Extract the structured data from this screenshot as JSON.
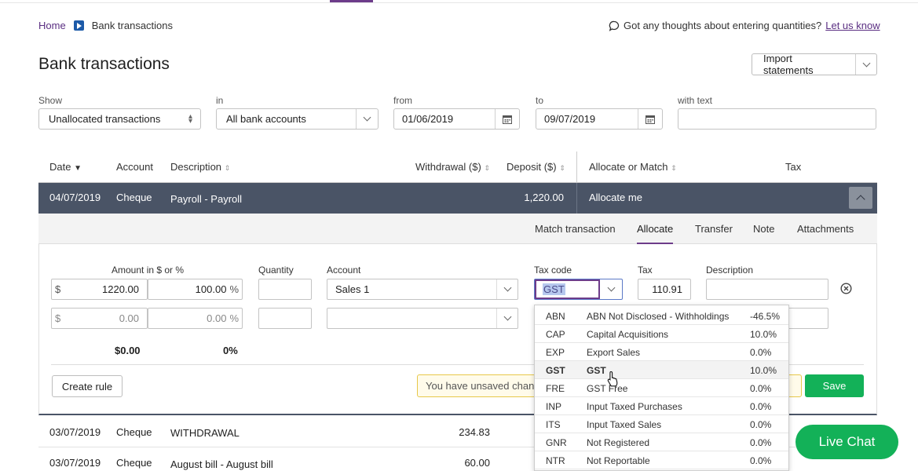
{
  "breadcrumb": {
    "home": "Home",
    "current": "Bank transactions"
  },
  "feedback": {
    "text": "Got any thoughts about entering quantities?",
    "link": "Let us know"
  },
  "page_title": "Bank transactions",
  "import_button": "Import statements",
  "filters": {
    "show_label": "Show",
    "show_value": "Unallocated transactions",
    "in_label": "in",
    "in_value": "All bank accounts",
    "from_label": "from",
    "from_value": "01/06/2019",
    "to_label": "to",
    "to_value": "09/07/2019",
    "text_label": "with text",
    "text_value": ""
  },
  "table": {
    "headers": {
      "date": "Date",
      "account": "Account",
      "description": "Description",
      "withdrawal": "Withdrawal ($)",
      "deposit": "Deposit ($)",
      "allocate": "Allocate or Match",
      "tax": "Tax"
    },
    "selected": {
      "date": "04/07/2019",
      "account": "Cheque",
      "description": "Payroll - Payroll",
      "deposit": "1,220.00",
      "allocate": "Allocate me"
    },
    "rows": [
      {
        "date": "03/07/2019",
        "account": "Cheque",
        "description": "WITHDRAWAL",
        "withdrawal": "234.83"
      },
      {
        "date": "03/07/2019",
        "account": "Cheque",
        "description": "August bill - August bill",
        "withdrawal": "60.00"
      }
    ]
  },
  "subtabs": [
    "Match transaction",
    "Allocate",
    "Transfer",
    "Note",
    "Attachments"
  ],
  "allocate": {
    "amount_label": "Amount in $ or %",
    "quantity_label": "Quantity",
    "account_label": "Account",
    "taxcode_label": "Tax code",
    "tax_label": "Tax",
    "description_label": "Description",
    "currency_symbol": "$",
    "percent_symbol": "%",
    "line1": {
      "amount": "1220.00",
      "percent": "100.00",
      "account": "Sales 1",
      "tax_code": "GST",
      "tax": "110.91"
    },
    "line2": {
      "amount": "0.00",
      "percent": "0.00"
    },
    "total_amount": "$0.00",
    "total_percent": "0%",
    "create_rule": "Create rule",
    "unsaved": "You have unsaved changes",
    "save": "Save"
  },
  "tax_codes": [
    {
      "code": "ABN",
      "name": "ABN Not Disclosed - Withholdings",
      "rate": "-46.5%"
    },
    {
      "code": "CAP",
      "name": "Capital Acquisitions",
      "rate": "10.0%"
    },
    {
      "code": "EXP",
      "name": "Export Sales",
      "rate": "0.0%"
    },
    {
      "code": "GST",
      "name": "GST",
      "rate": "10.0%"
    },
    {
      "code": "FRE",
      "name": "GST Free",
      "rate": "0.0%"
    },
    {
      "code": "INP",
      "name": "Input Taxed Purchases",
      "rate": "0.0%"
    },
    {
      "code": "ITS",
      "name": "Input Taxed Sales",
      "rate": "0.0%"
    },
    {
      "code": "GNR",
      "name": "Not Registered",
      "rate": "0.0%"
    },
    {
      "code": "NTR",
      "name": "Not Reportable",
      "rate": "0.0%"
    }
  ],
  "live_chat": "Live Chat",
  "colors": {
    "accent_purple": "#6d3c8a",
    "selected_row": "#4a5466",
    "green": "#13b158"
  }
}
